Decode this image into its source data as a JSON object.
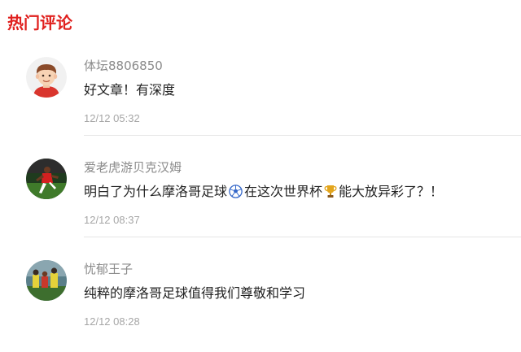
{
  "section": {
    "title": "热门评论"
  },
  "comments": [
    {
      "avatar_icon": "cartoon-boy-avatar",
      "username": "体坛8806850",
      "text": "好文章！有深度",
      "time": "12/12 05:32"
    },
    {
      "avatar_icon": "soccer-player-photo-avatar",
      "username": "爱老虎游贝克汉姆",
      "text_parts": [
        "明白了为什么摩洛哥足球",
        "在这次世界杯",
        "能大放异彩了？！"
      ],
      "emojis": [
        "soccer-ball-icon",
        "trophy-icon"
      ],
      "time": "12/12 08:37"
    },
    {
      "avatar_icon": "stadium-players-photo-avatar",
      "username": "忧郁王子",
      "text": "纯粹的摩洛哥足球值得我们尊敬和学习",
      "time": "12/12 08:28"
    }
  ],
  "colors": {
    "accent": "#e0201e",
    "username": "#8a8a8a",
    "text": "#222222",
    "time": "#a6a6a6",
    "divider": "#e6e6e6"
  }
}
